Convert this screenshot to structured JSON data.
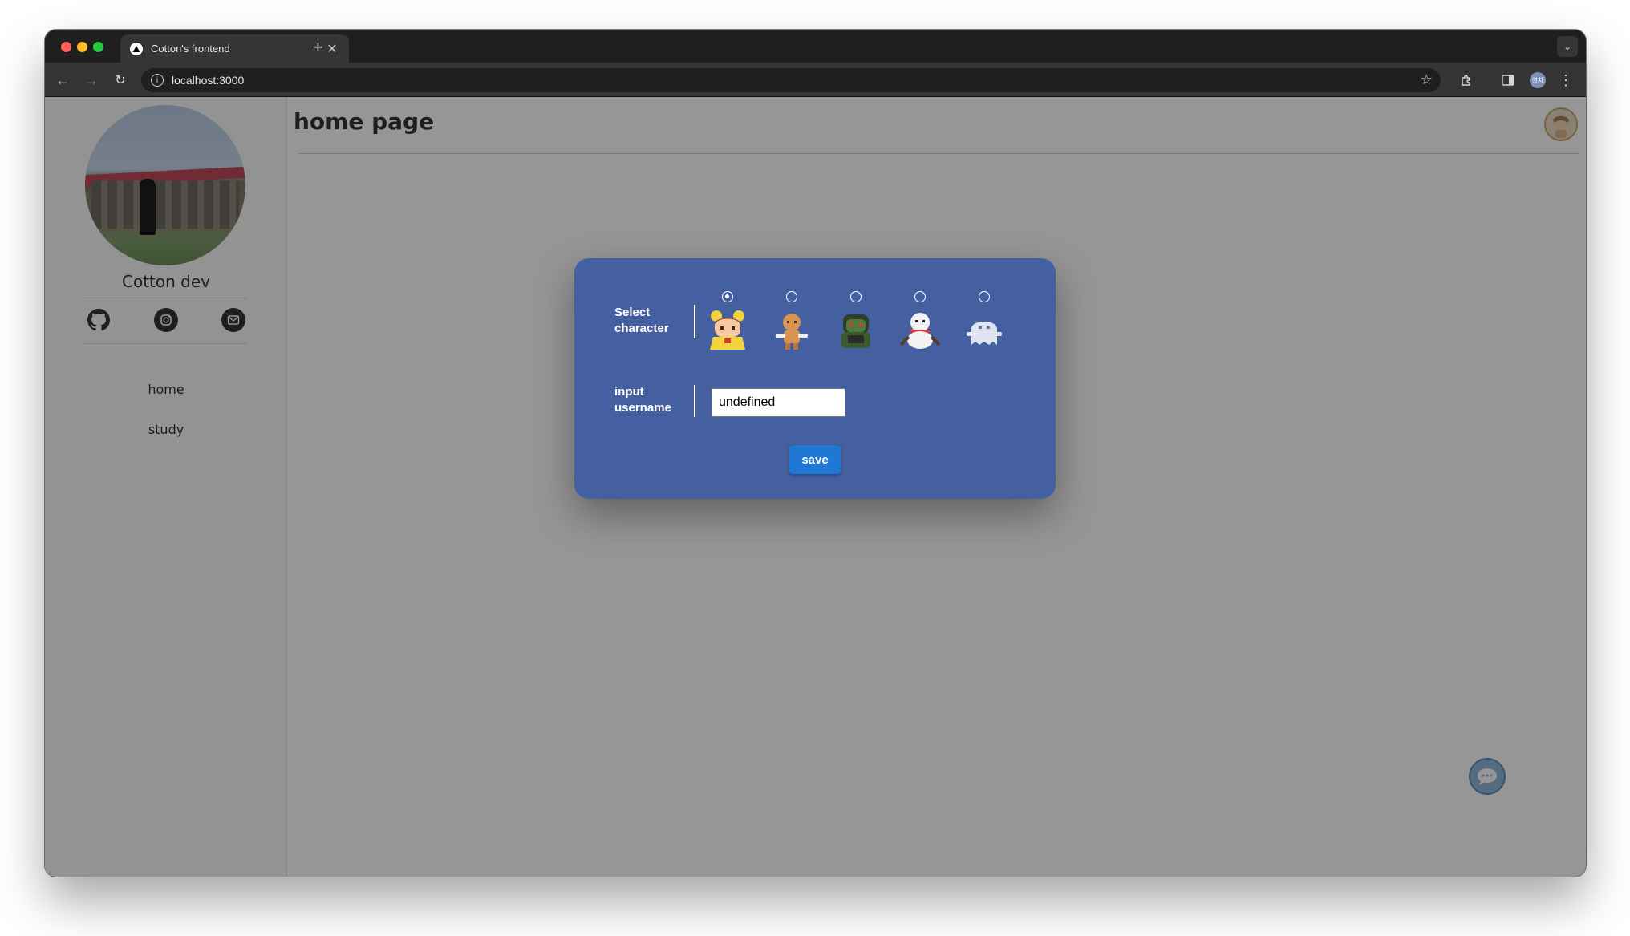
{
  "browser": {
    "tab_title": "Cotton's frontend",
    "new_tab": "+",
    "url": "localhost:3000",
    "profile_initials": "열차"
  },
  "sidebar": {
    "name": "Cotton dev",
    "social_icons": [
      "github-icon",
      "instagram-icon",
      "mail-icon"
    ],
    "nav_items": [
      {
        "label": "home"
      },
      {
        "label": "study"
      }
    ]
  },
  "main": {
    "title": "home page"
  },
  "modal": {
    "select_label": "Select character",
    "username_label": "input username",
    "characters": [
      {
        "name": "yellow-girl-character",
        "selected": true
      },
      {
        "name": "gingerbread-character",
        "selected": false
      },
      {
        "name": "green-ogre-character",
        "selected": false
      },
      {
        "name": "snowman-character",
        "selected": false
      },
      {
        "name": "ghost-character",
        "selected": false
      }
    ],
    "username_value": "undefined",
    "save_label": "save"
  },
  "colors": {
    "modal_bg": "#4460a0",
    "save_button": "#1e78d4",
    "overlay": "rgba(0,0,0,0.41)"
  }
}
